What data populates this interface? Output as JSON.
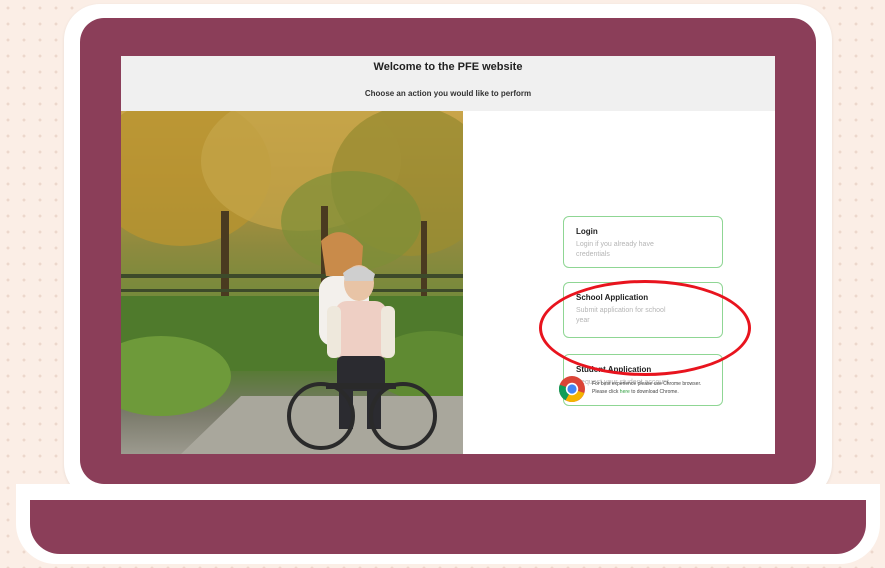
{
  "header": {
    "title": "Welcome to the PFE website",
    "subtitle": "Choose an action you would like to perform"
  },
  "cards": [
    {
      "title": "Login",
      "desc_line1": "Login if you already have",
      "desc_line2": "credentials"
    },
    {
      "title": "School Application",
      "desc_line1": "Submit application for school",
      "desc_line2": "year"
    },
    {
      "title": "Student Application",
      "desc_line1": "Request your student account",
      "desc_line2": ""
    }
  ],
  "browser_notice": {
    "line1": "For best experience please use Chrome browser.",
    "line2_prefix": "Please click ",
    "link_text": "here",
    "line2_suffix": " to download Chrome."
  },
  "colors": {
    "laptop_frame": "#8b3e59",
    "card_border": "#8fd694",
    "highlight": "#e8141e",
    "link": "#2e9e3e"
  },
  "icons": {
    "browser": "chrome-icon"
  }
}
